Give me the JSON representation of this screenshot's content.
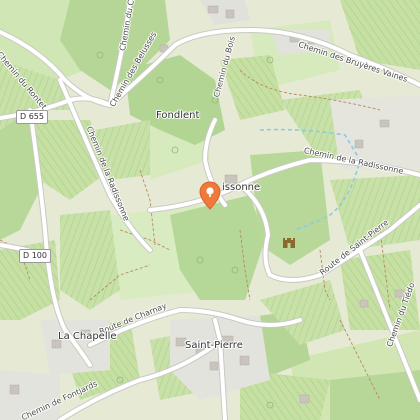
{
  "map": {
    "labels": {
      "fondlent": "Fondlent",
      "radissonne": "issonne",
      "la_chapelle": "La Chapelle",
      "saint_pierre": "Saint-Pierre",
      "ch_rontet": "Chemin du Rontet",
      "ch_ch": "Chemin du Ch",
      "ch_belusses": "Chemin des Belusses",
      "ch_bois": "Chemin du Bois",
      "ch_bruyeres": "Chemin des Bruyères Vaines",
      "ch_radissonne_w": "Chemin de la Radissonne",
      "ch_radissonne_e": "Chemin de la Radissonne",
      "rte_st_pierre": "Route de Saint-Pierre",
      "rte_charnay": "Route de Charnay",
      "ch_tiedo": "Chemin du Tiédo",
      "ch_fontjards": "Chemin de Fontjards"
    },
    "shields": {
      "d655": "D 655",
      "d100": "D 100"
    },
    "icons": {
      "pin": "location-pin-icon",
      "poi": "castle-icon"
    },
    "colors": {
      "background": "#e9edd8",
      "forest": "#b7d89a",
      "vineyard": "#c4dfa3",
      "meadow": "#d3e8b8",
      "road": "#ffffff",
      "pin": "#f07a3c",
      "water": "#8ec9e6"
    }
  }
}
